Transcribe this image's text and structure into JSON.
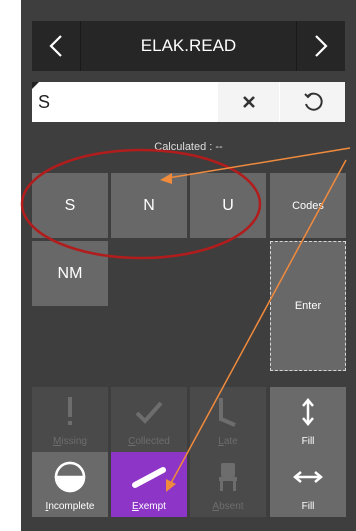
{
  "header": {
    "title": "ELAK.READ",
    "prev_icon": "chevron-left-icon",
    "next_icon": "chevron-right-icon"
  },
  "entry": {
    "value": "S",
    "clear_icon": "close-icon",
    "reset_icon": "undo-icon"
  },
  "calculated": {
    "text": "Calculated : --"
  },
  "codes": [
    {
      "label": "S"
    },
    {
      "label": "N"
    },
    {
      "label": "U"
    },
    {
      "label": "Codes"
    },
    {
      "label": "NM"
    },
    {
      "label": "Enter"
    }
  ],
  "tools": {
    "missing": {
      "first": "M",
      "rest": "issing",
      "icon": "exclamation-icon",
      "enabled": false
    },
    "collected": {
      "first": "C",
      "rest": "ollected",
      "icon": "checkmark-icon",
      "enabled": false
    },
    "late": {
      "first": "L",
      "rest": "ate",
      "icon": "late-icon",
      "enabled": false
    },
    "fill_vertical": {
      "label": "Fill",
      "icon": "vertical-arrows-icon",
      "enabled": true
    },
    "incomplete": {
      "first": "I",
      "rest": "ncomplete",
      "icon": "half-circle-icon",
      "enabled": true
    },
    "exempt": {
      "first": "E",
      "rest": "xempt",
      "icon": "exempt-slash-icon",
      "enabled": true,
      "selected": true
    },
    "absent": {
      "first": "A",
      "rest": "bsent",
      "icon": "chair-icon",
      "enabled": false
    },
    "fill_horizontal": {
      "label": "Fill",
      "icon": "horizontal-arrows-icon",
      "enabled": true
    }
  },
  "colors": {
    "panel": "#3e3e3e",
    "key": "#686868",
    "selected": "#8c35c6",
    "annotation_circle": "#b11c1c",
    "annotation_arrow": "#f08a3c"
  }
}
